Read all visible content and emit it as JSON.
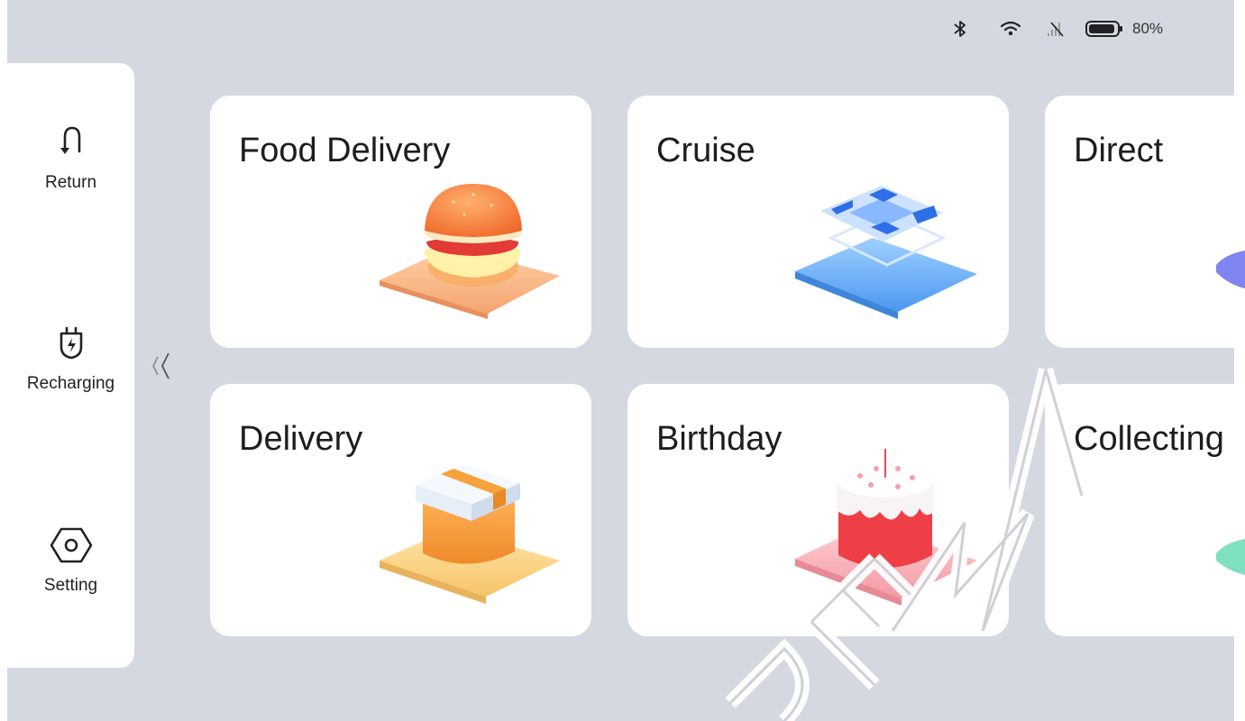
{
  "status": {
    "battery": "80%"
  },
  "sidebar": {
    "items": [
      {
        "label": "Return",
        "icon": "return-icon"
      },
      {
        "label": "Recharging",
        "icon": "charging-plug-icon"
      },
      {
        "label": "Setting",
        "icon": "gear-hexagon-icon"
      }
    ],
    "collapse_icon": "double-chevron-left-icon"
  },
  "cards": [
    {
      "title": "Food Delivery",
      "icon": "burger-illustration"
    },
    {
      "title": "Cruise",
      "icon": "cruise-illustration"
    },
    {
      "title": "Direct",
      "icon": "direct-illustration"
    },
    {
      "title": "Delivery",
      "icon": "box-illustration"
    },
    {
      "title": "Birthday",
      "icon": "cake-illustration"
    },
    {
      "title": "Collecting",
      "icon": "collecting-illustration"
    }
  ],
  "watermark": "DEMY"
}
